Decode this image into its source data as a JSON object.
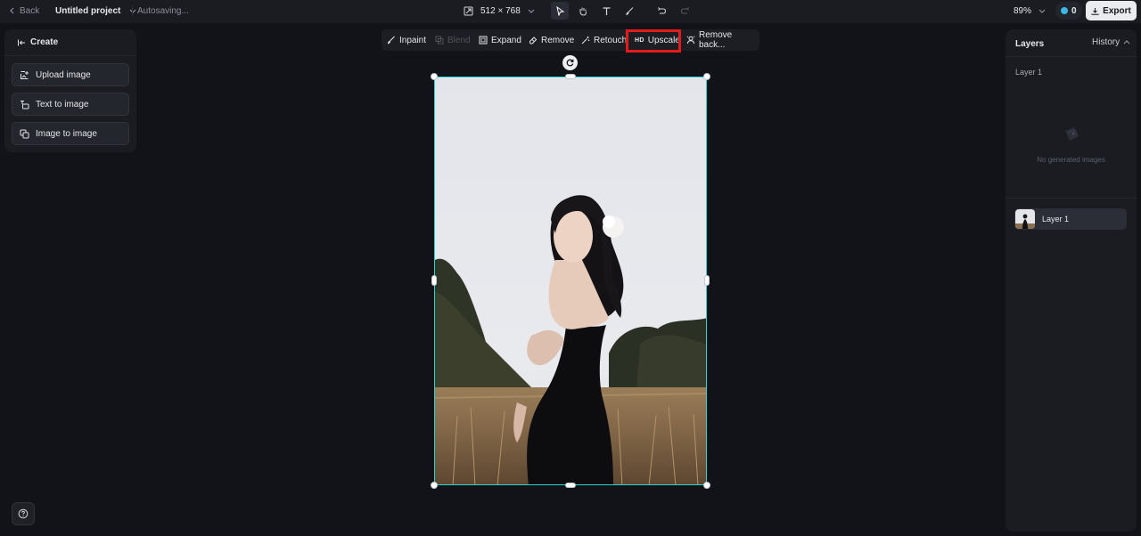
{
  "topbar": {
    "back_label": "Back",
    "project_title": "Untitled project",
    "autosave_label": "Autosaving...",
    "canvas_size": "512 × 768",
    "tools": [
      "select-arrow-icon",
      "hand-icon",
      "text-icon",
      "brush-icon",
      "undo-icon",
      "redo-icon"
    ],
    "zoom": "89%",
    "credits": "0",
    "export_label": "Export"
  },
  "create": {
    "title": "Create",
    "buttons": [
      "Upload image",
      "Text to image",
      "Image to image"
    ]
  },
  "edit_toolbar": {
    "inpaint": "Inpaint",
    "blend": "Blend",
    "expand": "Expand",
    "remove": "Remove",
    "retouch": "Retouch",
    "upscale_badge": "HD",
    "upscale": "Upscale",
    "remove_bg": "Remove back..."
  },
  "layers_panel": {
    "title": "Layers",
    "history_label": "History",
    "section_label": "Layer 1",
    "empty_text": "No generated images",
    "layer_name": "Layer 1"
  },
  "colors": {
    "background": "#121318",
    "panel": "#1a1c22",
    "selection": "#2fd6d1",
    "highlight": "#e31b1b",
    "export_bg": "#e9ebef",
    "credit_dot": "#3db6e8"
  }
}
